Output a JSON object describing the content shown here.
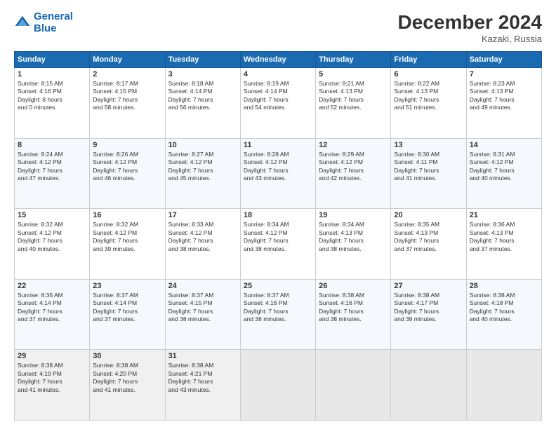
{
  "header": {
    "logo_line1": "General",
    "logo_line2": "Blue",
    "month": "December 2024",
    "location": "Kazaki, Russia"
  },
  "weekdays": [
    "Sunday",
    "Monday",
    "Tuesday",
    "Wednesday",
    "Thursday",
    "Friday",
    "Saturday"
  ],
  "weeks": [
    [
      {
        "day": "1",
        "lines": [
          "Sunrise: 8:15 AM",
          "Sunset: 4:16 PM",
          "Daylight: 8 hours",
          "and 0 minutes."
        ]
      },
      {
        "day": "2",
        "lines": [
          "Sunrise: 8:17 AM",
          "Sunset: 4:15 PM",
          "Daylight: 7 hours",
          "and 58 minutes."
        ]
      },
      {
        "day": "3",
        "lines": [
          "Sunrise: 8:18 AM",
          "Sunset: 4:14 PM",
          "Daylight: 7 hours",
          "and 56 minutes."
        ]
      },
      {
        "day": "4",
        "lines": [
          "Sunrise: 8:19 AM",
          "Sunset: 4:14 PM",
          "Daylight: 7 hours",
          "and 54 minutes."
        ]
      },
      {
        "day": "5",
        "lines": [
          "Sunrise: 8:21 AM",
          "Sunset: 4:13 PM",
          "Daylight: 7 hours",
          "and 52 minutes."
        ]
      },
      {
        "day": "6",
        "lines": [
          "Sunrise: 8:22 AM",
          "Sunset: 4:13 PM",
          "Daylight: 7 hours",
          "and 51 minutes."
        ]
      },
      {
        "day": "7",
        "lines": [
          "Sunrise: 8:23 AM",
          "Sunset: 4:13 PM",
          "Daylight: 7 hours",
          "and 49 minutes."
        ]
      }
    ],
    [
      {
        "day": "8",
        "lines": [
          "Sunrise: 8:24 AM",
          "Sunset: 4:12 PM",
          "Daylight: 7 hours",
          "and 47 minutes."
        ]
      },
      {
        "day": "9",
        "lines": [
          "Sunrise: 8:26 AM",
          "Sunset: 4:12 PM",
          "Daylight: 7 hours",
          "and 46 minutes."
        ]
      },
      {
        "day": "10",
        "lines": [
          "Sunrise: 8:27 AM",
          "Sunset: 4:12 PM",
          "Daylight: 7 hours",
          "and 45 minutes."
        ]
      },
      {
        "day": "11",
        "lines": [
          "Sunrise: 8:28 AM",
          "Sunset: 4:12 PM",
          "Daylight: 7 hours",
          "and 43 minutes."
        ]
      },
      {
        "day": "12",
        "lines": [
          "Sunrise: 8:29 AM",
          "Sunset: 4:12 PM",
          "Daylight: 7 hours",
          "and 42 minutes."
        ]
      },
      {
        "day": "13",
        "lines": [
          "Sunrise: 8:30 AM",
          "Sunset: 4:11 PM",
          "Daylight: 7 hours",
          "and 41 minutes."
        ]
      },
      {
        "day": "14",
        "lines": [
          "Sunrise: 8:31 AM",
          "Sunset: 4:12 PM",
          "Daylight: 7 hours",
          "and 40 minutes."
        ]
      }
    ],
    [
      {
        "day": "15",
        "lines": [
          "Sunrise: 8:32 AM",
          "Sunset: 4:12 PM",
          "Daylight: 7 hours",
          "and 40 minutes."
        ]
      },
      {
        "day": "16",
        "lines": [
          "Sunrise: 8:32 AM",
          "Sunset: 4:12 PM",
          "Daylight: 7 hours",
          "and 39 minutes."
        ]
      },
      {
        "day": "17",
        "lines": [
          "Sunrise: 8:33 AM",
          "Sunset: 4:12 PM",
          "Daylight: 7 hours",
          "and 38 minutes."
        ]
      },
      {
        "day": "18",
        "lines": [
          "Sunrise: 8:34 AM",
          "Sunset: 4:12 PM",
          "Daylight: 7 hours",
          "and 38 minutes."
        ]
      },
      {
        "day": "19",
        "lines": [
          "Sunrise: 8:34 AM",
          "Sunset: 4:13 PM",
          "Daylight: 7 hours",
          "and 38 minutes."
        ]
      },
      {
        "day": "20",
        "lines": [
          "Sunrise: 8:35 AM",
          "Sunset: 4:13 PM",
          "Daylight: 7 hours",
          "and 37 minutes."
        ]
      },
      {
        "day": "21",
        "lines": [
          "Sunrise: 8:36 AM",
          "Sunset: 4:13 PM",
          "Daylight: 7 hours",
          "and 37 minutes."
        ]
      }
    ],
    [
      {
        "day": "22",
        "lines": [
          "Sunrise: 8:36 AM",
          "Sunset: 4:14 PM",
          "Daylight: 7 hours",
          "and 37 minutes."
        ]
      },
      {
        "day": "23",
        "lines": [
          "Sunrise: 8:37 AM",
          "Sunset: 4:14 PM",
          "Daylight: 7 hours",
          "and 37 minutes."
        ]
      },
      {
        "day": "24",
        "lines": [
          "Sunrise: 8:37 AM",
          "Sunset: 4:15 PM",
          "Daylight: 7 hours",
          "and 38 minutes."
        ]
      },
      {
        "day": "25",
        "lines": [
          "Sunrise: 8:37 AM",
          "Sunset: 4:16 PM",
          "Daylight: 7 hours",
          "and 38 minutes."
        ]
      },
      {
        "day": "26",
        "lines": [
          "Sunrise: 8:38 AM",
          "Sunset: 4:16 PM",
          "Daylight: 7 hours",
          "and 38 minutes."
        ]
      },
      {
        "day": "27",
        "lines": [
          "Sunrise: 8:38 AM",
          "Sunset: 4:17 PM",
          "Daylight: 7 hours",
          "and 39 minutes."
        ]
      },
      {
        "day": "28",
        "lines": [
          "Sunrise: 8:38 AM",
          "Sunset: 4:18 PM",
          "Daylight: 7 hours",
          "and 40 minutes."
        ]
      }
    ],
    [
      {
        "day": "29",
        "lines": [
          "Sunrise: 8:38 AM",
          "Sunset: 4:19 PM",
          "Daylight: 7 hours",
          "and 41 minutes."
        ]
      },
      {
        "day": "30",
        "lines": [
          "Sunrise: 8:38 AM",
          "Sunset: 4:20 PM",
          "Daylight: 7 hours",
          "and 41 minutes."
        ]
      },
      {
        "day": "31",
        "lines": [
          "Sunrise: 8:38 AM",
          "Sunset: 4:21 PM",
          "Daylight: 7 hours",
          "and 43 minutes."
        ]
      },
      null,
      null,
      null,
      null
    ]
  ]
}
